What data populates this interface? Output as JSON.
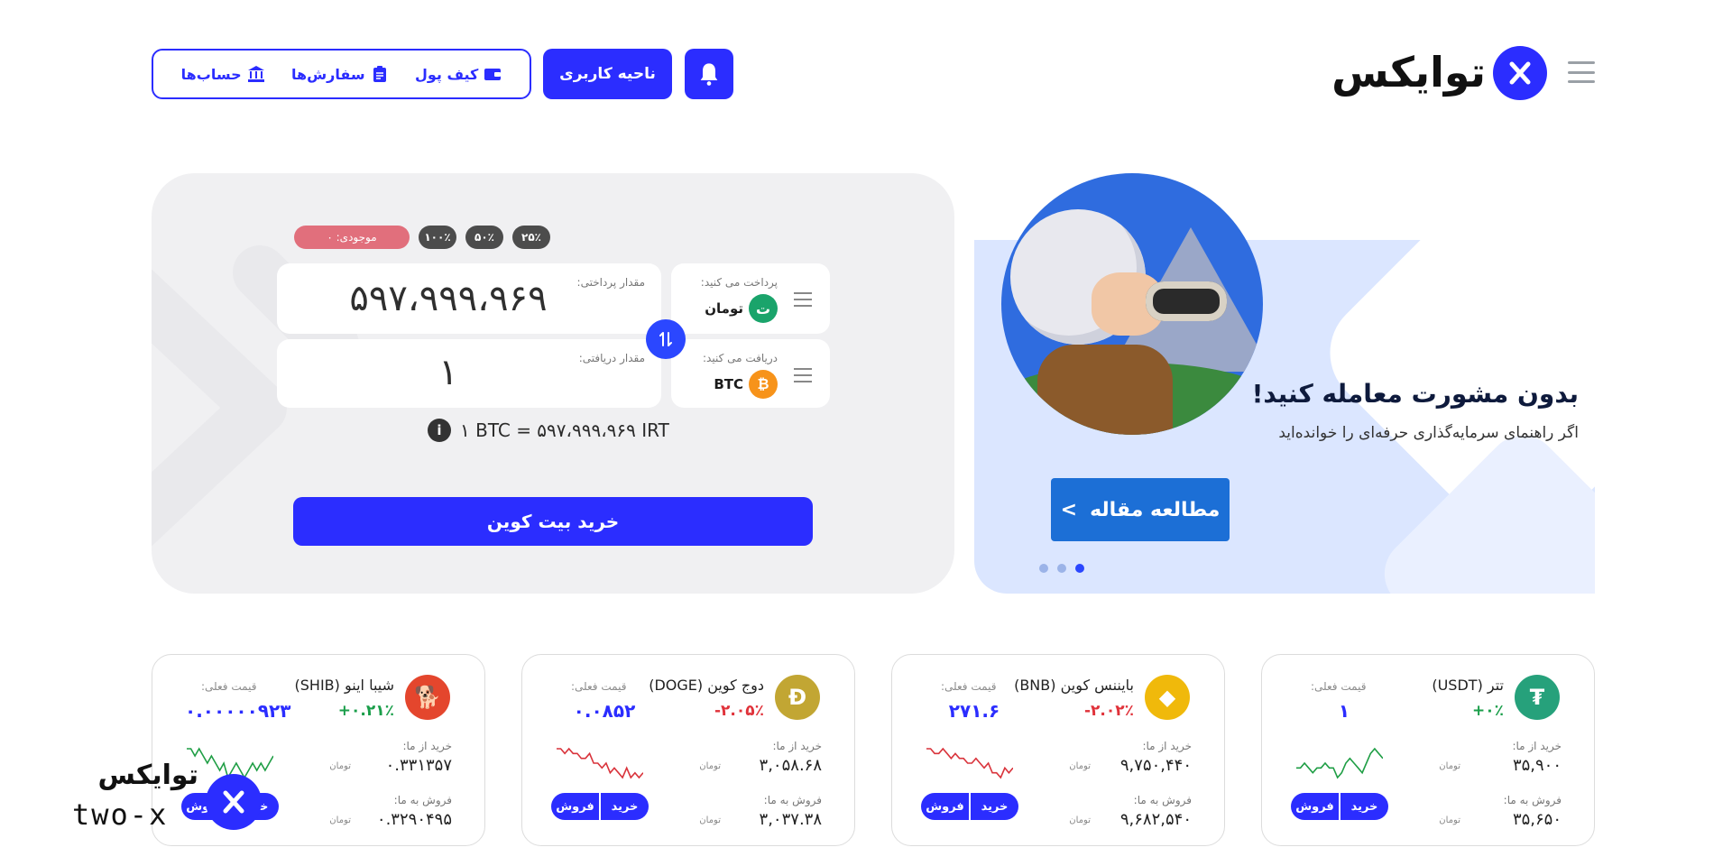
{
  "header": {
    "logo_text": "توایکس",
    "dashboard_label": "ناحیه کاربری",
    "nav": [
      {
        "label": "کیف پول",
        "icon": "wallet-icon"
      },
      {
        "label": "سفارش‌ها",
        "icon": "clipboard-icon"
      },
      {
        "label": "حساب‌ها",
        "icon": "bank-icon"
      }
    ]
  },
  "banner": {
    "title": "بدون مشورت معامله کنید!",
    "subtitle": "اگر راهنمای سرمایه‌گذاری حرفه‌ای را خوانده‌اید",
    "button_label": "مطالعه مقاله",
    "button_arrow": ">",
    "slides": 3,
    "active_slide": 3
  },
  "exchange": {
    "balance_label": "موجودی: ۰",
    "percent_options": [
      "۲۵٪",
      "۵۰٪",
      "۱۰۰٪"
    ],
    "pay": {
      "label": "پرداخت می کنید:",
      "currency": "تومان",
      "currency_symbol": "ت",
      "amount_label": "مقدار پرداختی:",
      "amount": "۵۹۷،۹۹۹،۹۶۹"
    },
    "receive": {
      "label": "دریافت می کنید:",
      "currency": "BTC",
      "currency_symbol": "₿",
      "amount_label": "مقدار دریافتی:",
      "amount": "۱"
    },
    "rate": "۱ BTC = ۵۹۷،۹۹۹،۹۶۹ IRT",
    "info_glyph": "i",
    "buy_label": "خرید بیت کوین"
  },
  "coins": [
    {
      "name": "تتر (USDT)",
      "symbol": "₮",
      "color": "#26a17b",
      "change": "+۰٪",
      "change_color": "#1a9e4a",
      "current_label": "قیمت فعلی:",
      "current": "۱",
      "buy_label": "خرید از ما:",
      "buy": "۳۵,۹۰۰",
      "sell_label": "فروش به ما:",
      "sell": "۳۵,۶۵۰",
      "unit": "تومان",
      "spark_color": "#1f9e45",
      "spark": [
        5,
        5,
        6,
        5,
        4,
        5,
        5,
        6,
        5,
        5,
        3,
        4,
        6,
        7,
        6,
        5,
        4,
        6,
        8,
        9,
        8,
        7
      ],
      "buy_btn": "خرید",
      "sell_btn": "فروش"
    },
    {
      "name": "بایننس کوین (BNB)",
      "symbol": "◆",
      "color": "#f0b90b",
      "change": "-۲.۰۲٪",
      "change_color": "#e0323a",
      "current_label": "قیمت فعلی:",
      "current": "۲۷۱.۶",
      "buy_label": "خرید از ما:",
      "buy": "۹,۷۵۰,۴۴۰",
      "sell_label": "فروش به ما:",
      "sell": "۹,۶۸۲,۵۴۰",
      "unit": "تومان",
      "spark_color": "#d9333b",
      "spark": [
        9,
        9,
        8,
        8,
        9,
        8,
        7,
        8,
        7,
        7,
        6,
        6,
        7,
        6,
        5,
        6,
        4,
        4,
        3,
        5,
        4,
        5
      ],
      "buy_btn": "خرید",
      "sell_btn": "فروش"
    },
    {
      "name": "دوج کوین (DOGE)",
      "symbol": "Ð",
      "color": "#c2a633",
      "change": "-۲.۰۵٪",
      "change_color": "#e0323a",
      "current_label": "قیمت فعلی:",
      "current": "۰.۰۸۵۲",
      "buy_label": "خرید از ما:",
      "buy": "۳,۰۵۸.۶۸",
      "sell_label": "فروش به ما:",
      "sell": "۳,۰۳۷.۳۸",
      "unit": "تومان",
      "spark_color": "#d9333b",
      "spark": [
        9,
        9,
        8,
        9,
        8,
        8,
        7,
        7,
        8,
        6,
        6,
        5,
        6,
        4,
        5,
        4,
        3,
        5,
        3,
        4,
        3,
        4
      ],
      "buy_btn": "خرید",
      "sell_btn": "فروش"
    },
    {
      "name": "شیبا اینو (SHIB)",
      "symbol": "🐕",
      "color": "#e4462d",
      "change": "+۰.۲۱٪",
      "change_color": "#1a9e4a",
      "current_label": "قیمت فعلی:",
      "current": "۰.۰۰۰۰۰۹۲۳",
      "buy_label": "خرید از ما:",
      "buy": "۰.۳۳۱۳۵۷",
      "sell_label": "فروش به ما:",
      "sell": "۰.۳۲۹۰۴۹۵",
      "unit": "تومان",
      "spark_color": "#1f9e45",
      "spark": [
        7,
        7,
        6,
        7,
        6,
        5,
        6,
        5,
        4,
        5,
        3,
        4,
        5,
        4,
        3,
        4,
        5,
        4,
        5,
        4,
        5,
        6
      ],
      "buy_btn": "خرید",
      "sell_btn": "فروش"
    }
  ],
  "brand": {
    "fa": "توایکس",
    "en": "two-x"
  }
}
